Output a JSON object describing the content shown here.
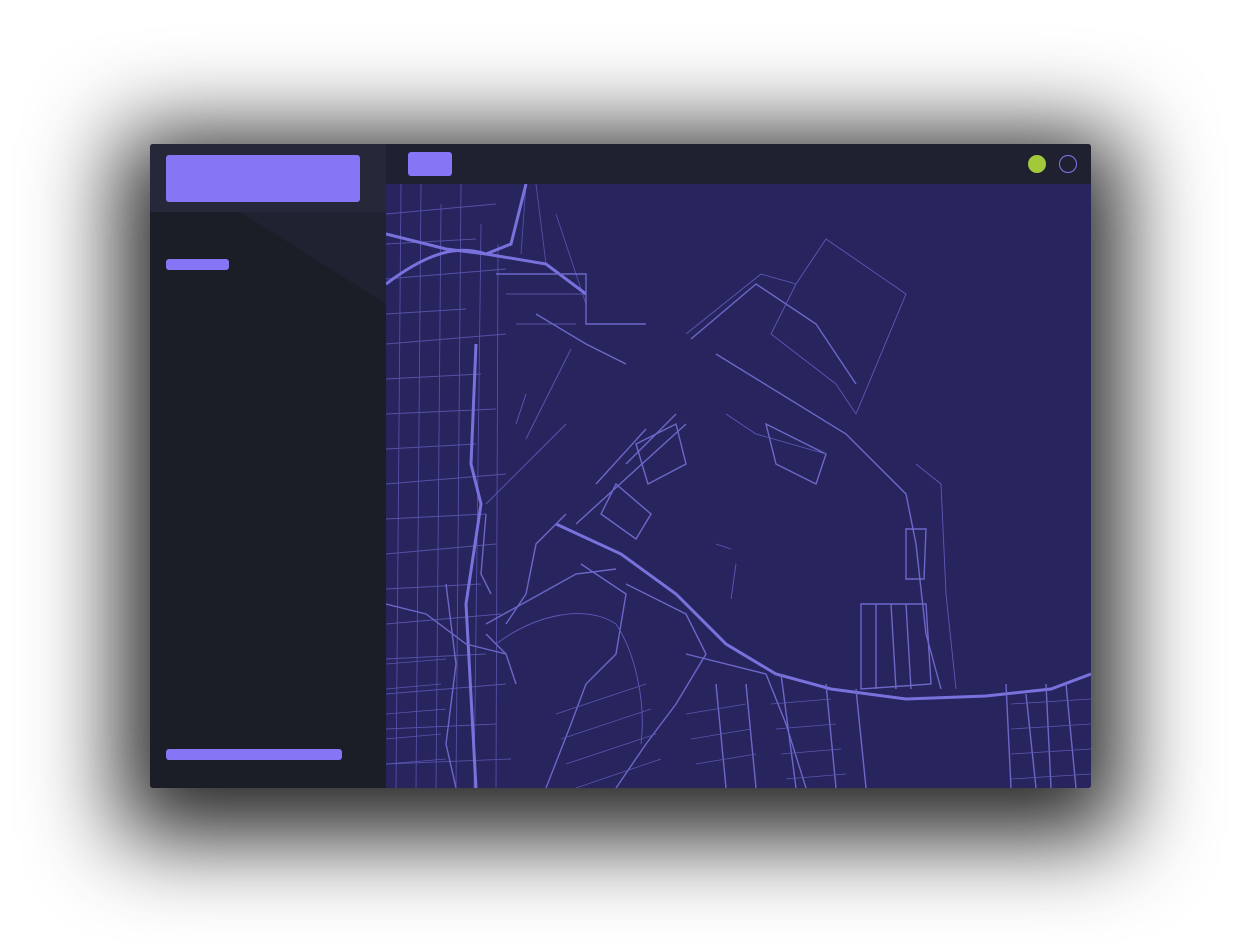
{
  "window": {
    "title": ""
  },
  "sidebar": {
    "brand_label": "",
    "section_label": "",
    "footer_label": ""
  },
  "topbar": {
    "button_label": "",
    "status": "online"
  },
  "map": {
    "style": "dark-purple street map",
    "background_color": "#28245e",
    "road_color": "#6e67c8"
  },
  "colors": {
    "accent": "#8675f5",
    "status_online": "#a3c93a",
    "sidebar_bg": "#1b1d27",
    "topbar_bg": "#1f2130"
  },
  "icons": [
    "status-dot-icon",
    "ring-toggle-icon"
  ]
}
